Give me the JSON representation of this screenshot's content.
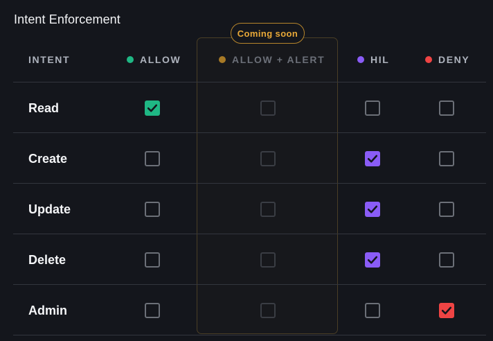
{
  "title": "Intent Enforcement",
  "badge": "Coming soon",
  "columns": [
    {
      "key": "intent",
      "label": "INTENT"
    },
    {
      "key": "allow",
      "label": "ALLOW",
      "dot_color": "#1fb784",
      "check_color": "#1fb784"
    },
    {
      "key": "allow_alert",
      "label": "ALLOW + ALERT",
      "dot_color": "#a87a26",
      "disabled": true
    },
    {
      "key": "hil",
      "label": "HIL",
      "dot_color": "#8a5cf6",
      "check_color": "#8a5cf6"
    },
    {
      "key": "deny",
      "label": "DENY",
      "dot_color": "#ef4444",
      "check_color": "#ef4444"
    }
  ],
  "rows": [
    {
      "label": "Read",
      "allow": true,
      "allow_alert": false,
      "hil": false,
      "deny": false
    },
    {
      "label": "Create",
      "allow": false,
      "allow_alert": false,
      "hil": true,
      "deny": false
    },
    {
      "label": "Update",
      "allow": false,
      "allow_alert": false,
      "hil": true,
      "deny": false
    },
    {
      "label": "Delete",
      "allow": false,
      "allow_alert": false,
      "hil": true,
      "deny": false
    },
    {
      "label": "Admin",
      "allow": false,
      "allow_alert": false,
      "hil": false,
      "deny": true
    }
  ],
  "colors": {
    "background": "#14161c",
    "badge": "#e8a838",
    "check_mark": "#14161c"
  }
}
